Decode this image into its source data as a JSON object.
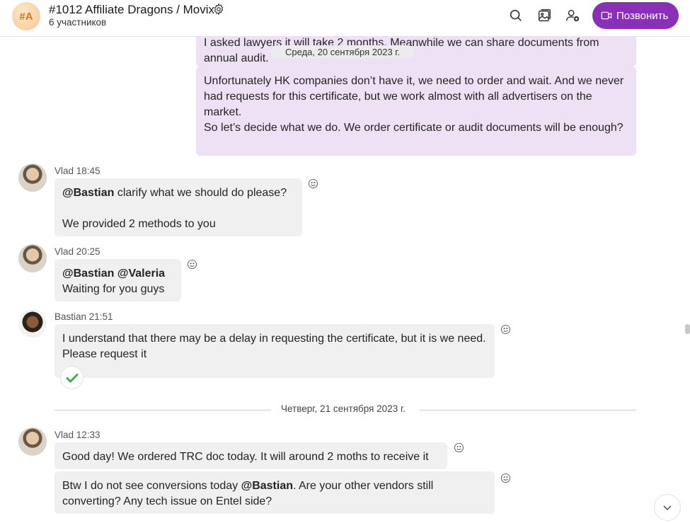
{
  "header": {
    "avatar_initials": "#A",
    "title": "#1012 Affiliate Dragons / Movix",
    "participants": "6 участников",
    "call_label": "Позвонить",
    "icons": [
      "search-icon",
      "gallery-icon",
      "add-person-icon",
      "gear-icon",
      "video-call-icon"
    ],
    "accent_color": "#8a2fb8"
  },
  "chat": {
    "own_msg_1": {
      "line1": "I asked lawyers it will take 2 months. Meanwhile we can share documents from",
      "line2": "annual audit."
    },
    "date_pill": "Среда, 20 сентября 2023 г.",
    "own_msg_2": {
      "text1": "Unfortunately HK companies don’t have it, we need to order and wait. And we never had requests for this certificate, but we work almost with all advertisers on the market.",
      "text2": "So let’s decide what we do. We order certificate or audit documents will be enough?"
    },
    "msg_vlad_1": {
      "meta": "Vlad 18:45",
      "mention": "@Bastian",
      "text": " clarify what we should do please?",
      "text2": "We provided 2 methods to you"
    },
    "msg_vlad_2": {
      "meta": "Vlad 20:25",
      "mentions": "@Bastian @Valeria",
      "text": "Waiting for you guys"
    },
    "msg_bastian": {
      "meta": "Bastian 21:51",
      "text": "I understand that there may be a delay in requesting the certificate, but it is we need. Please request it",
      "reaction": "check-mark"
    },
    "date_divider": "Четверг, 21 сентября 2023 г.",
    "msg_vlad_3": {
      "meta": "Vlad 12:33",
      "text": "Good day! We ordered TRC doc today. It will around 2 moths to receive it",
      "text2_a": "Btw I do not see conversions today ",
      "mention": "@Bastian",
      "text2_b": ". Are your other vendors still converting? Any tech issue on Entel side?"
    }
  }
}
